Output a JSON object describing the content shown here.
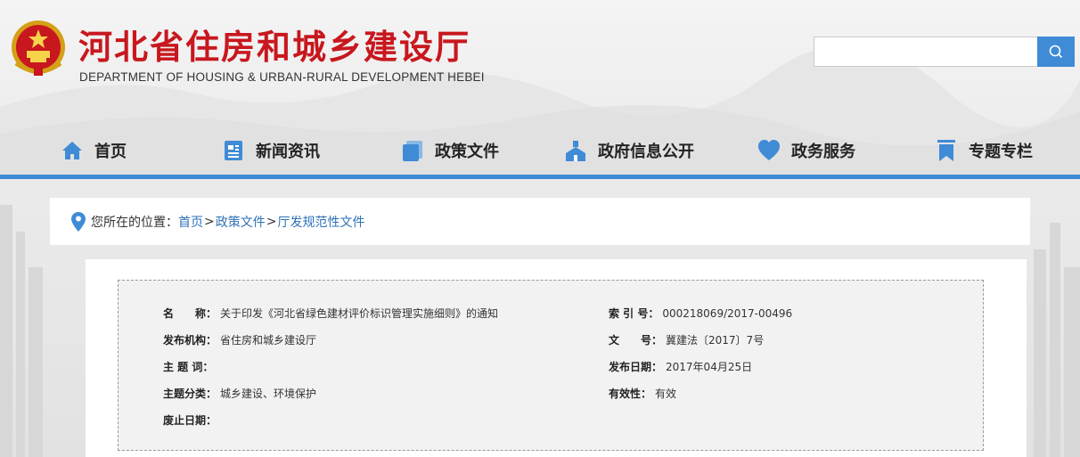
{
  "header": {
    "title": "河北省住房和城乡建设厅",
    "subtitle": "DEPARTMENT OF HOUSING & URBAN-RURAL DEVELOPMENT HEBEI",
    "emblem_icon": "national-emblem-icon",
    "brand_color": "#c8171e"
  },
  "search": {
    "placeholder": "",
    "value": "",
    "button_icon": "search-icon",
    "accent": "#3f8bd6"
  },
  "nav": {
    "items": [
      {
        "label": "首页",
        "icon": "home-icon"
      },
      {
        "label": "新闻资讯",
        "icon": "news-icon"
      },
      {
        "label": "政策文件",
        "icon": "document-icon"
      },
      {
        "label": "政府信息公开",
        "icon": "info-public-icon"
      },
      {
        "label": "政务服务",
        "icon": "heart-service-icon"
      },
      {
        "label": "专题专栏",
        "icon": "bookmark-icon"
      }
    ]
  },
  "breadcrumb": {
    "prefix": "您所在的位置：",
    "items": [
      "首页",
      "政策文件",
      "厅发规范性文件"
    ],
    "separator": ">"
  },
  "meta": {
    "name_label": "名　　称：",
    "name_value": "关于印发《河北省绿色建材评价标识管理实施细则》的通知",
    "index_label": "索 引 号：",
    "index_value": "000218069/2017-00496",
    "org_label": "发布机构：",
    "org_value": "省住房和城乡建设厅",
    "docno_label": "文　　号：",
    "docno_value": "冀建法〔2017〕7号",
    "keywords_label": "主 题 词：",
    "keywords_value": "",
    "date_label": "发布日期：",
    "date_value": "2017年04月25日",
    "category_label": "主题分类：",
    "category_value": "城乡建设、环境保护",
    "validity_label": "有效性：",
    "validity_value": "有效",
    "expiry_label": "废止日期：",
    "expiry_value": ""
  }
}
